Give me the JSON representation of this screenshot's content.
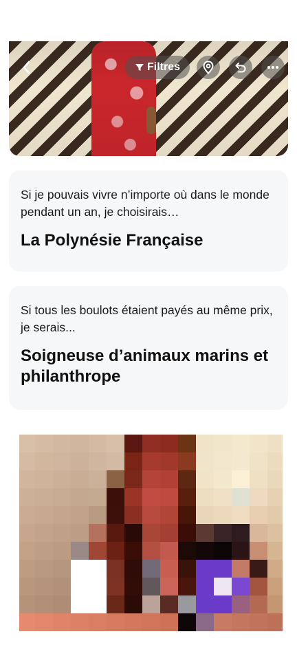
{
  "toolbar": {
    "back_icon": "chevron-left-icon",
    "filters_icon": "filter-icon",
    "filters_label": "Filtres",
    "location_icon": "location-pin-icon",
    "undo_icon": "undo-icon",
    "more_icon": "more-horizontal-icon"
  },
  "prompts": [
    {
      "question": "Si je pouvais vivre n’importe où dans le monde pendant un an, je choisirais…",
      "answer": "La Polynésie Française"
    },
    {
      "question": "Si tous les boulots étaient payés au même prix, je serais...",
      "answer": "Soigneuse d’animaux marins et philanthrope"
    }
  ],
  "colors": {
    "card_bg": "#f6f7f9",
    "text": "#1a1a1a"
  }
}
